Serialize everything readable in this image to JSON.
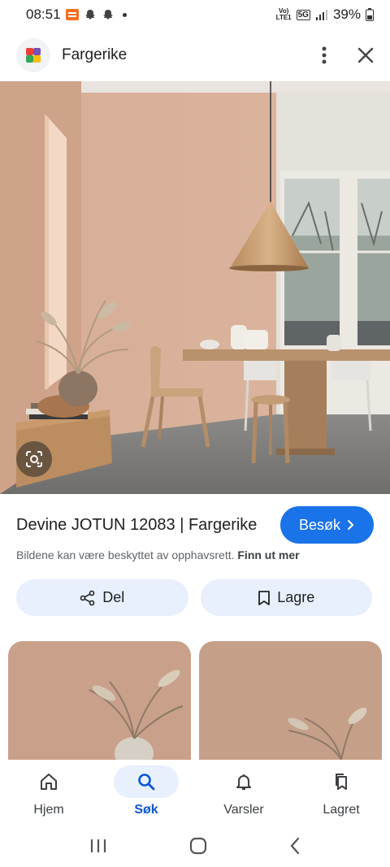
{
  "status_bar": {
    "time": "08:51",
    "network_top": "Vo)",
    "network_bottom": "LTE1",
    "network_5g": "5G",
    "battery": "39%"
  },
  "header": {
    "site_name": "Fargerike"
  },
  "result": {
    "title": "Devine JOTUN 12083 | Fargerike",
    "visit_label": "Besøk",
    "copyright_text": "Bildene kan være beskyttet av opphavsrett.",
    "learn_more": "Finn ut mer"
  },
  "actions": {
    "share_label": "Del",
    "save_label": "Lagre"
  },
  "bottom_nav": {
    "items": [
      {
        "label": "Hjem",
        "icon": "home-icon"
      },
      {
        "label": "Søk",
        "icon": "search-icon",
        "active": true
      },
      {
        "label": "Varsler",
        "icon": "bell-icon"
      },
      {
        "label": "Lagret",
        "icon": "bookmarks-icon"
      }
    ]
  },
  "colors": {
    "accent": "#1a73e8",
    "pill_bg": "#e8f0fe",
    "wall": "#d8ae98"
  }
}
